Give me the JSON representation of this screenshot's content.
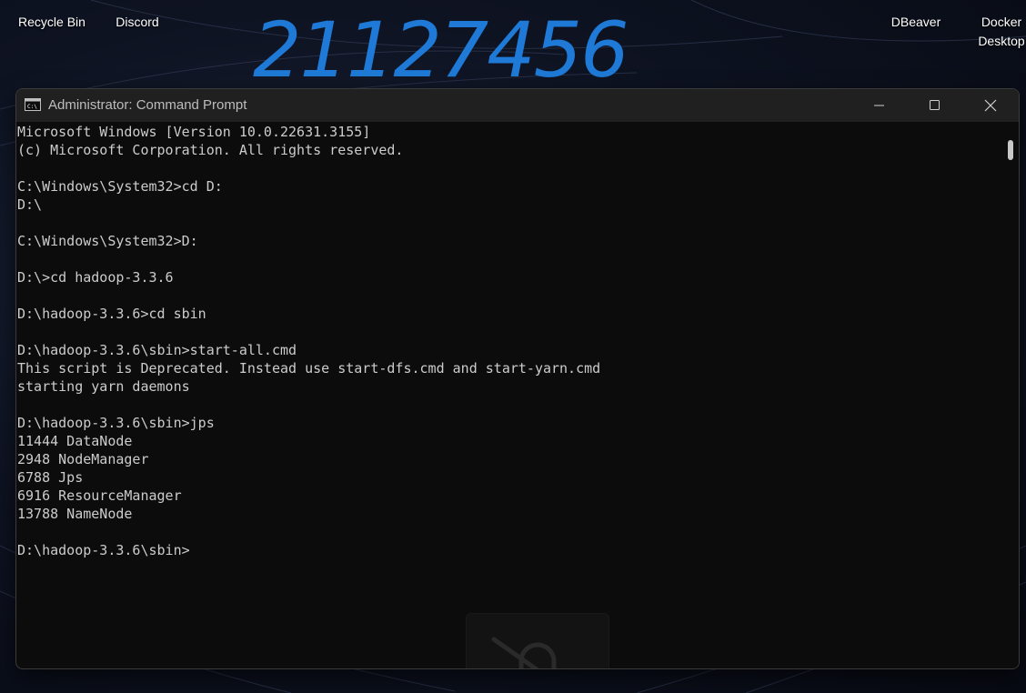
{
  "desktop": {
    "icons": [
      {
        "label": "Recycle Bin"
      },
      {
        "label": "Discord"
      },
      {
        "label": "DBeaver"
      },
      {
        "label": "Docker Desktop"
      }
    ],
    "handwritten_text": "21127456"
  },
  "window": {
    "title": "Administrator: Command Prompt",
    "icon": "cmd-icon",
    "controls": {
      "minimize_icon": "minimize-icon",
      "maximize_icon": "maximize-icon",
      "close_icon": "close-icon"
    },
    "console_lines": [
      "Microsoft Windows [Version 10.0.22631.3155]",
      "(c) Microsoft Corporation. All rights reserved.",
      "",
      "C:\\Windows\\System32>cd D:",
      "D:\\",
      "",
      "C:\\Windows\\System32>D:",
      "",
      "D:\\>cd hadoop-3.3.6",
      "",
      "D:\\hadoop-3.3.6>cd sbin",
      "",
      "D:\\hadoop-3.3.6\\sbin>start-all.cmd",
      "This script is Deprecated. Instead use start-dfs.cmd and start-yarn.cmd",
      "starting yarn daemons",
      "",
      "D:\\hadoop-3.3.6\\sbin>jps",
      "11444 DataNode",
      "2948 NodeManager",
      "6788 Jps",
      "6916 ResourceManager",
      "13788 NameNode",
      "",
      "D:\\hadoop-3.3.6\\sbin>"
    ]
  },
  "colors": {
    "console_bg": "#0c0c0c",
    "console_text": "#cccccc",
    "titlebar_bg": "#202020",
    "handwriting": "#1e7ad6"
  }
}
